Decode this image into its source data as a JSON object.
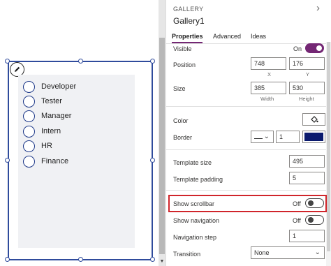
{
  "gallery_items": [
    "Developer",
    "Tester",
    "Manager",
    "Intern",
    "HR",
    "Finance"
  ],
  "pane": {
    "header": "GALLERY",
    "title": "Gallery1",
    "tabs": [
      "Properties",
      "Advanced",
      "Ideas"
    ]
  },
  "props": {
    "visible_label": "Visible",
    "visible_state": "On",
    "position_label": "Position",
    "position_x": "748",
    "position_y": "176",
    "x_label": "X",
    "y_label": "Y",
    "size_label": "Size",
    "size_w": "385",
    "size_h": "530",
    "width_label": "Width",
    "height_label": "Height",
    "color_label": "Color",
    "border_label": "Border",
    "border_width": "1",
    "template_size_label": "Template size",
    "template_size": "495",
    "template_padding_label": "Template padding",
    "template_padding": "5",
    "show_scrollbar_label": "Show scrollbar",
    "show_scrollbar_state": "Off",
    "show_navigation_label": "Show navigation",
    "show_navigation_state": "Off",
    "navigation_step_label": "Navigation step",
    "navigation_step": "1",
    "transition_label": "Transition",
    "transition_value": "None"
  },
  "colors": {
    "accent": "#742774",
    "selection": "#2f4b9c",
    "highlight": "#d0252b",
    "border_swatch": "#0b1a6e"
  }
}
